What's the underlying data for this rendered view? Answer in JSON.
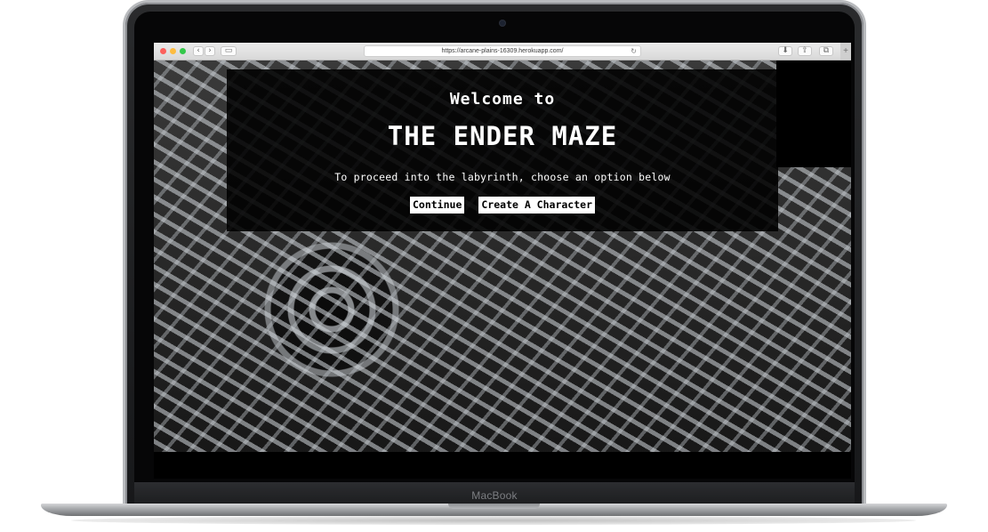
{
  "laptop": {
    "brand": "MacBook"
  },
  "browser": {
    "url": "https://arcane-plains-16309.herokuapp.com/",
    "back_glyph": "‹",
    "forward_glyph": "›",
    "sidebar_glyph": "▭",
    "reload_glyph": "↻",
    "download_glyph": "⬇",
    "share_glyph": "⇪",
    "tabs_glyph": "⧉",
    "new_tab_glyph": "+"
  },
  "page": {
    "welcome": "Welcome to",
    "title": "THE ENDER MAZE",
    "subtitle": "To proceed into the labyrinth, choose an option below",
    "buttons": {
      "continue": "Continue",
      "create": "Create A Character"
    }
  },
  "colors": {
    "panel_bg": "#000000",
    "button_bg": "#ffffff",
    "text": "#ffffff"
  }
}
